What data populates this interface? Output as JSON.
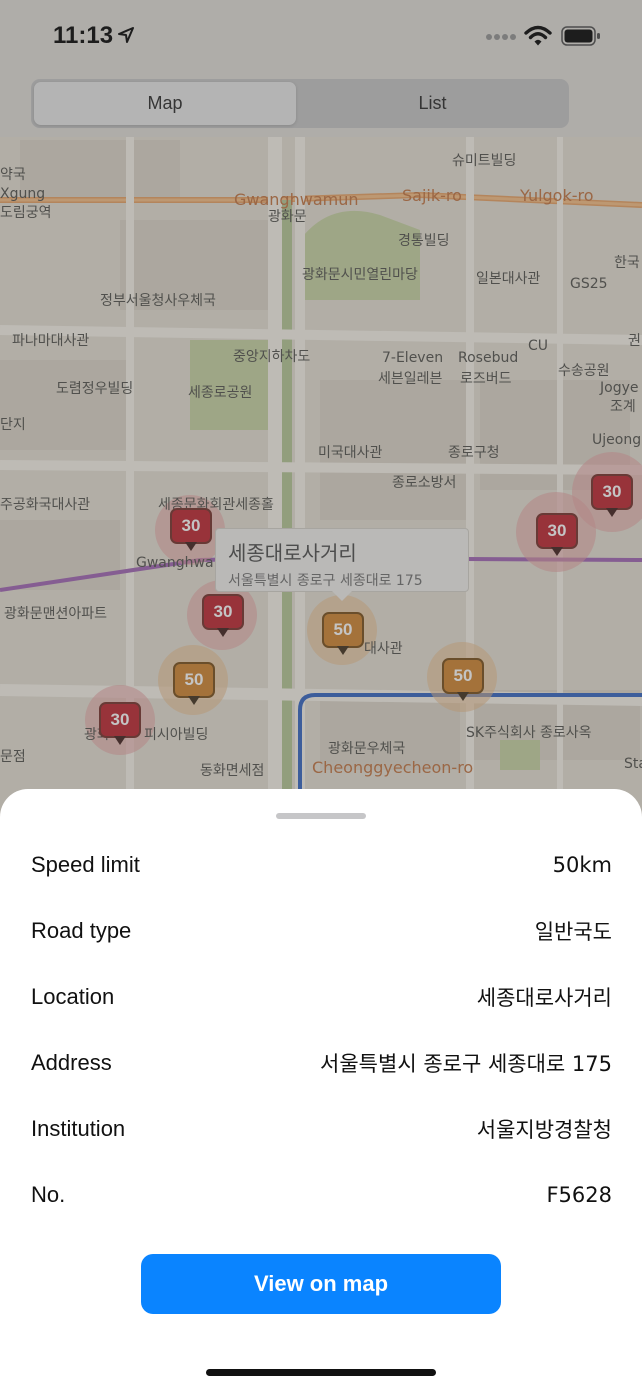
{
  "status": {
    "time": "11:13"
  },
  "segments": {
    "map": "Map",
    "list": "List",
    "selected": "Map"
  },
  "map": {
    "callout": {
      "title": "세종대로사거리",
      "address": "서울특별시 종로구 세종대로 175"
    },
    "labels": [
      "슈미트빌딩",
      "Gwanghwamun",
      "광화문",
      "Sajik-ro",
      "Yulgok-ro",
      "경통빌딩",
      "광화문시민열린마당",
      "일본대사관",
      "GS25",
      "정부서울청사우체국",
      "파나마대사관",
      "중앙지하차도",
      "7-Eleven",
      "세븐일레븐",
      "Rosebud",
      "로즈버드",
      "CU",
      "수송공원",
      "도렴정우빌딩",
      "세종로공원",
      "미국대사관",
      "종로구청",
      "Ujeong",
      "종로소방서",
      "세종문화회관세종홀",
      "광화문맨션아파트",
      "대사관",
      "SK주식회사 종로사옥",
      "피시아빌딩",
      "광화문우체국",
      "동화면세점",
      "Cheonggyecheon-ro",
      "Gwanghwa",
      "Jogye",
      "조계",
      "한국",
      "약국",
      "Xgung",
      "도림궁역",
      "단지",
      "주공화국대사관",
      "문점",
      "광화",
      "권",
      "Sta"
    ],
    "markers": [
      {
        "value": "30",
        "color": "red"
      },
      {
        "value": "30",
        "color": "red"
      },
      {
        "value": "30",
        "color": "red"
      },
      {
        "value": "30",
        "color": "red"
      },
      {
        "value": "30",
        "color": "red"
      },
      {
        "value": "50",
        "color": "orange"
      },
      {
        "value": "50",
        "color": "orange"
      },
      {
        "value": "50",
        "color": "orange"
      }
    ]
  },
  "details": {
    "rows": [
      {
        "label": "Speed limit",
        "value": "50km"
      },
      {
        "label": "Road type",
        "value": "일반국도"
      },
      {
        "label": "Location",
        "value": "세종대로사거리"
      },
      {
        "label": "Address",
        "value": "서울특별시 종로구 세종대로 175"
      },
      {
        "label": "Institution",
        "value": "서울지방경찰청"
      },
      {
        "label": "No.",
        "value": "F5628"
      }
    ],
    "button": "View on map"
  },
  "colors": {
    "accent": "#0a84ff",
    "marker_red": "#c0303a",
    "marker_orange": "#d18a3a"
  }
}
